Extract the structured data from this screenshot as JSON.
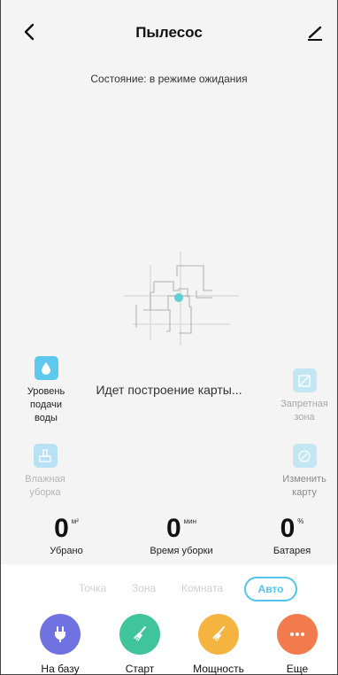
{
  "header": {
    "title": "Пылесос",
    "back_icon": "chevron-left-icon",
    "edit_icon": "pencil-icon"
  },
  "status_text": "Состояние: в режиме ожидания",
  "map_status": "Идет построение карты...",
  "side_controls": {
    "water_level": "Уровень подачи воды",
    "wet_cleaning": "Влажная уборка",
    "restricted_zone": "Запретная зона",
    "edit_map": "Изменить карту"
  },
  "stats": {
    "area": {
      "value": "0",
      "unit": "м²",
      "label": "Убрано"
    },
    "time": {
      "value": "0",
      "unit": "мин",
      "label": "Время уборки"
    },
    "battery": {
      "value": "0",
      "unit": "%",
      "label": "Батарея"
    }
  },
  "modes": [
    "Точка",
    "Зона",
    "Комната",
    "Авто"
  ],
  "active_mode": "Авто",
  "actions": {
    "base": "На базу",
    "start": "Старт",
    "power": "Мощность",
    "more": "Еще"
  },
  "colors": {
    "accent": "#4fc6ea",
    "base": "#6f72e0",
    "start": "#3fc49c",
    "power": "#f5b33f",
    "more": "#f27b4e"
  }
}
